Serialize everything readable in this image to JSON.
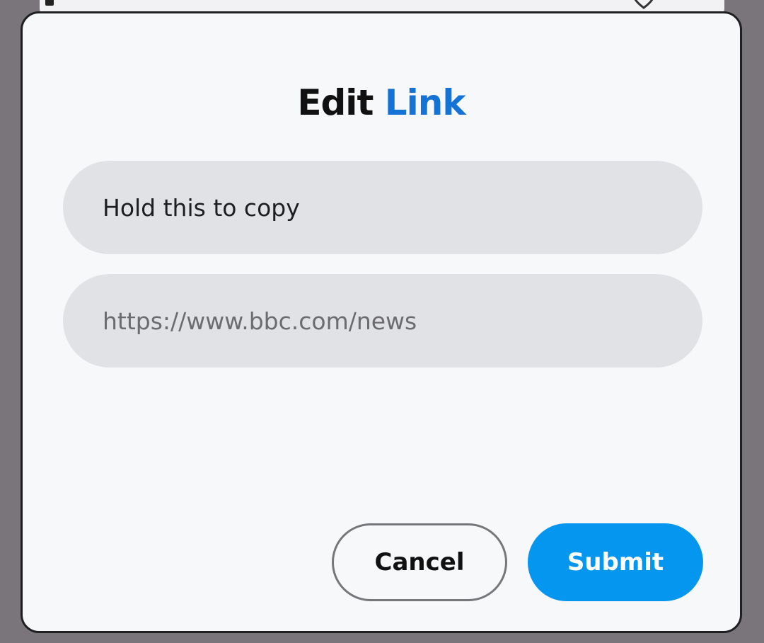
{
  "dialog": {
    "title_part1": "Edit",
    "title_part2": "Link",
    "text_field_value": "Hold this to copy",
    "url_field_value": "https://www.bbc.com/news",
    "cancel_label": "Cancel",
    "submit_label": "Submit"
  },
  "colors": {
    "accent": "#1673d6",
    "submit_bg": "#0596f0",
    "field_bg": "#e1e2e6",
    "dialog_bg": "#f7f8fa",
    "scrim": "#7a757a"
  },
  "icons": {
    "background_icon": "heart-icon"
  }
}
